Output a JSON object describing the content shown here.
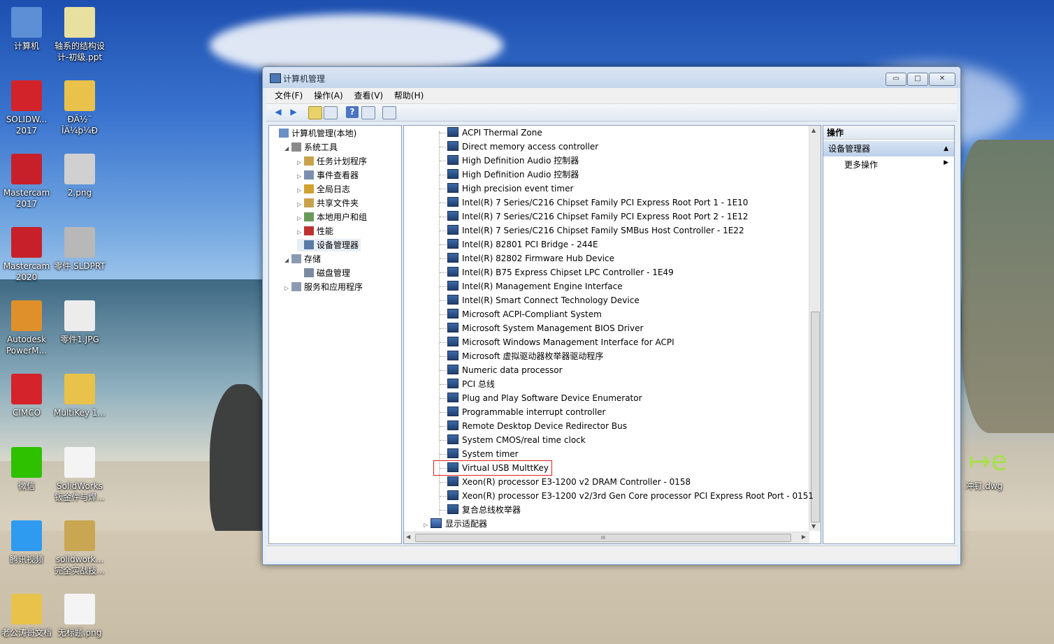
{
  "desktop": {
    "icons": [
      {
        "label": "计算机",
        "icon": "computer-icon",
        "color": "#5c8fd6"
      },
      {
        "label": "轴系的结构设\n计-初级.ppt",
        "icon": "ppt-file-icon",
        "color": "#e8e0a0"
      },
      {
        "label": "SOLIDW...\n2017",
        "icon": "solidworks-icon",
        "color": "#d2222a"
      },
      {
        "label": "ĐÂ½¨\nÎÄ¼þ¼Ð",
        "icon": "folder-icon",
        "color": "#e8c24a"
      },
      {
        "label": "Mastercam\n2017",
        "icon": "mastercam-icon",
        "color": "#c8202a"
      },
      {
        "label": "2.png",
        "icon": "image-file-icon",
        "color": "#d0d0d0"
      },
      {
        "label": "Mastercam\n2020",
        "icon": "mastercam-icon",
        "color": "#c8202a"
      },
      {
        "label": "零件.SLDPRT",
        "icon": "part-file-icon",
        "color": "#b8b8b8"
      },
      {
        "label": "Autodesk\nPowerM...",
        "icon": "powermill-icon",
        "color": "#e0902a"
      },
      {
        "label": "零件1.JPG",
        "icon": "image-file-icon",
        "color": "#ececec"
      },
      {
        "label": "CIMCO",
        "icon": "cimco-icon",
        "color": "#d4232a"
      },
      {
        "label": "MultiKey 1...",
        "icon": "folder-icon",
        "color": "#e8c24a"
      },
      {
        "label": "微信",
        "icon": "wechat-icon",
        "color": "#2dc100"
      },
      {
        "label": "SolidWorks\n钣金件与焊...",
        "icon": "document-icon",
        "color": "#f4f4f4"
      },
      {
        "label": "腾讯视频",
        "icon": "tencent-video-icon",
        "color": "#2f9bf0"
      },
      {
        "label": "solidwork...\n完全实战技...",
        "icon": "book-icon",
        "color": "#c9a652"
      },
      {
        "label": "老公涛哥文档",
        "icon": "folder-icon",
        "color": "#e8c24a"
      },
      {
        "label": "无标题.png",
        "icon": "image-file-icon",
        "color": "#f4f4f4"
      }
    ],
    "right_icon": {
      "label": "冲钉.dwg",
      "icon": "dwg-file-icon"
    }
  },
  "window": {
    "title": "计算机管理",
    "buttons": {
      "minimize": "▭",
      "maximize": "□",
      "close": "✕"
    },
    "menu": [
      "文件(F)",
      "操作(A)",
      "查看(V)",
      "帮助(H)"
    ],
    "tree": [
      {
        "label": "计算机管理(本地)",
        "level": 0,
        "expander": "",
        "icon": "computer-management-icon"
      },
      {
        "label": "系统工具",
        "level": 1,
        "expander": "◢",
        "icon": "tools-icon"
      },
      {
        "label": "任务计划程序",
        "level": 2,
        "expander": "▷",
        "icon": "clock-icon"
      },
      {
        "label": "事件查看器",
        "level": 2,
        "expander": "▷",
        "icon": "event-viewer-icon"
      },
      {
        "label": "全局日志",
        "level": 2,
        "expander": "▷",
        "icon": "log-icon"
      },
      {
        "label": "共享文件夹",
        "level": 2,
        "expander": "▷",
        "icon": "shared-folder-icon"
      },
      {
        "label": "本地用户和组",
        "level": 2,
        "expander": "▷",
        "icon": "users-icon"
      },
      {
        "label": "性能",
        "level": 2,
        "expander": "▷",
        "icon": "performance-icon"
      },
      {
        "label": "设备管理器",
        "level": 2,
        "expander": "",
        "icon": "device-manager-icon",
        "selected": true
      },
      {
        "label": "存储",
        "level": 1,
        "expander": "◢",
        "icon": "storage-icon"
      },
      {
        "label": "磁盘管理",
        "level": 2,
        "expander": "",
        "icon": "disk-icon"
      },
      {
        "label": "服务和应用程序",
        "level": 1,
        "expander": "▷",
        "icon": "services-icon"
      }
    ],
    "devices": [
      "ACPI Thermal Zone",
      "Direct memory access controller",
      "High Definition Audio 控制器",
      "High Definition Audio 控制器",
      "High precision event timer",
      "Intel(R) 7 Series/C216 Chipset Family PCI Express Root Port 1 - 1E10",
      "Intel(R) 7 Series/C216 Chipset Family PCI Express Root Port 2 - 1E12",
      "Intel(R) 7 Series/C216 Chipset Family SMBus Host Controller - 1E22",
      "Intel(R) 82801 PCI Bridge - 244E",
      "Intel(R) 82802 Firmware Hub Device",
      "Intel(R) B75 Express Chipset LPC Controller - 1E49",
      "Intel(R) Management Engine Interface",
      "Intel(R) Smart Connect Technology Device",
      "Microsoft ACPI-Compliant System",
      "Microsoft System Management BIOS Driver",
      "Microsoft Windows Management Interface for ACPI",
      "Microsoft 虚拟驱动器枚举器驱动程序",
      "Numeric data processor",
      "PCI 总线",
      "Plug and Play Software Device Enumerator",
      "Programmable interrupt controller",
      "Remote Desktop Device Redirector Bus",
      "System CMOS/real time clock",
      "System timer",
      "Virtual USB MulttKey",
      "Xeon(R) processor E3-1200 v2 DRAM Controller - 0158",
      "Xeon(R) processor E3-1200 v2/3rd Gen Core processor PCI Express Root Port - 0151",
      "复合总线枚举器"
    ],
    "next_category": "显示适配器",
    "actions": {
      "header": "操作",
      "section": "设备管理器",
      "more": "更多操作"
    },
    "scroll": {
      "hsb_mark": "III"
    }
  }
}
